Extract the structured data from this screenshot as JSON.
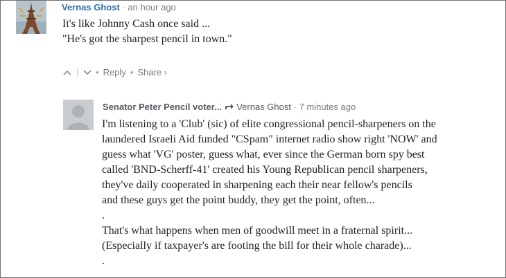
{
  "comments": [
    {
      "author": "Vernas Ghost",
      "time": "an hour ago",
      "lines": [
        "It's like Johnny Cash once said ...",
        "\"He's got the sharpest pencil in town.\""
      ],
      "actions": {
        "reply": "Reply",
        "share": "Share ›"
      }
    },
    {
      "author": "Senator Peter Pencil voter...",
      "reply_to": "Vernas Ghost",
      "time": "7 minutes ago",
      "lines": [
        "I'm listening to a 'Club' (sic) of elite congressional pencil-sharpeners on the",
        "laundered Israeli Aid funded \"CSpam\" internet radio show right 'NOW' and",
        "guess what 'VG' poster, guess what, ever since the German born spy best",
        "called 'BND-Scherff-41' created his Young Republican pencil sharpeners,",
        "they've daily cooperated in sharpening each their near fellow's pencils",
        "and these guys get the point buddy, they get the point, often...",
        ".",
        "That's what happens when men of goodwill meet in a fraternal spirit...",
        "(Especially if taxpayer's are footing the bill for their whole charade)...",
        "."
      ]
    }
  ],
  "icons": {
    "upvote": "chevron-up-icon",
    "downvote": "chevron-down-icon",
    "reply_arrow": "reply-arrow-icon",
    "avatar_1": "eiffel-tower-avatar",
    "avatar_2": "default-user-avatar"
  },
  "colors": {
    "author_link": "#2e6fb0",
    "meta_text": "#7a7a7a",
    "body_text": "#222222"
  }
}
